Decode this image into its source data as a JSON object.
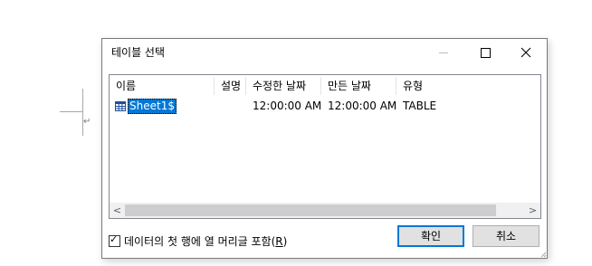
{
  "document": {
    "paragraph_mark": "↵"
  },
  "dialog": {
    "title": "테이블 선택",
    "window_buttons": {
      "minimize_icon": "minimize-icon",
      "maximize_icon": "maximize-icon",
      "close_icon": "close-icon",
      "close_glyph": "✕"
    },
    "list": {
      "columns": [
        "이름",
        "설명",
        "수정한 날짜",
        "만든 날짜",
        "유형"
      ],
      "rows": [
        {
          "icon": "table-icon",
          "name": "Sheet1$",
          "description": "",
          "modified": "12:00:00 AM",
          "created": "12:00:00 AM",
          "type": "TABLE",
          "selected": true
        }
      ],
      "scroll_left_glyph": "<",
      "scroll_right_glyph": ">"
    },
    "checkbox": {
      "label_prefix": "데이터의 첫 행에 열 머리글 포함(",
      "accelerator": "R",
      "label_suffix": ")",
      "checked": true,
      "check_glyph": "✓"
    },
    "buttons": {
      "ok_label": "확인",
      "cancel_label": "취소"
    },
    "colors": {
      "selection": "#0078d7",
      "button_face": "#e1e1e1",
      "default_button_border": "#0078d7"
    }
  }
}
